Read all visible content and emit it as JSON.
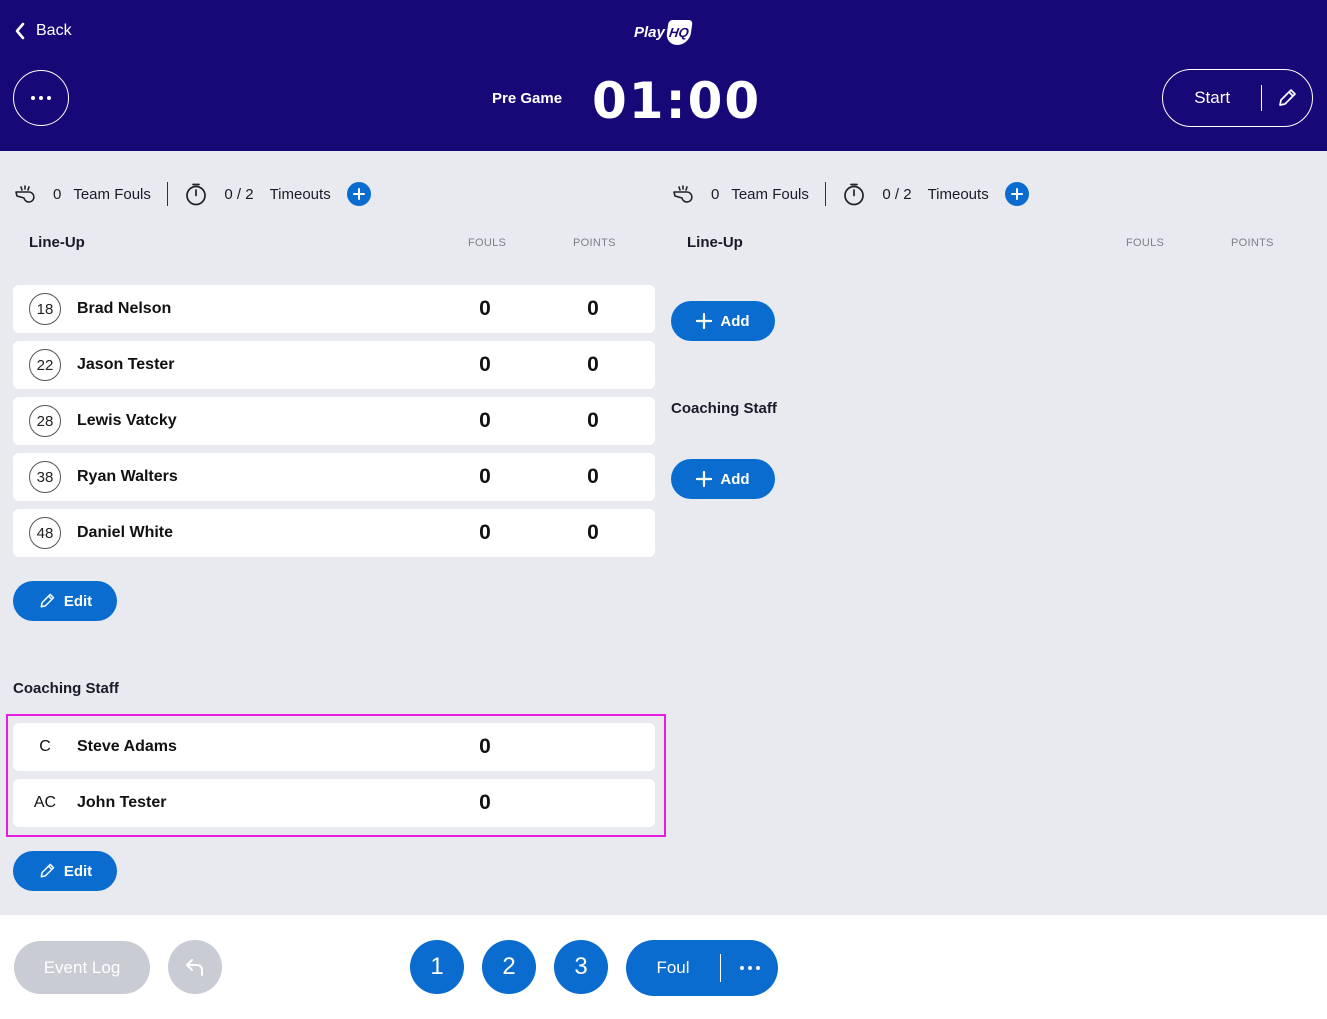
{
  "header": {
    "back_label": "Back",
    "logo_text": "Play",
    "logo_badge": "HQ",
    "period": "Pre Game",
    "clock": "01:00",
    "start_label": "Start"
  },
  "home": {
    "team_fouls_count": "0",
    "team_fouls_label": "Team Fouls",
    "timeouts_value": "0 / 2",
    "timeouts_label": "Timeouts",
    "lineup_title": "Line-Up",
    "fouls_header": "FOULS",
    "points_header": "POINTS",
    "players": [
      {
        "number": "18",
        "name": "Brad Nelson",
        "fouls": "0",
        "points": "0"
      },
      {
        "number": "22",
        "name": "Jason Tester",
        "fouls": "0",
        "points": "0"
      },
      {
        "number": "28",
        "name": "Lewis Vatcky",
        "fouls": "0",
        "points": "0"
      },
      {
        "number": "38",
        "name": "Ryan Walters",
        "fouls": "0",
        "points": "0"
      },
      {
        "number": "48",
        "name": "Daniel White",
        "fouls": "0",
        "points": "0"
      }
    ],
    "lineup_edit_label": "Edit",
    "coaching_title": "Coaching Staff",
    "staff": [
      {
        "role": "C",
        "name": "Steve Adams",
        "fouls": "0"
      },
      {
        "role": "AC",
        "name": "John Tester",
        "fouls": "0"
      }
    ],
    "staff_edit_label": "Edit"
  },
  "away": {
    "team_fouls_count": "0",
    "team_fouls_label": "Team Fouls",
    "timeouts_value": "0 / 2",
    "timeouts_label": "Timeouts",
    "lineup_title": "Line-Up",
    "fouls_header": "FOULS",
    "points_header": "POINTS",
    "lineup_add_label": "Add",
    "coaching_title": "Coaching Staff",
    "staff_add_label": "Add"
  },
  "footer": {
    "event_log_label": "Event Log",
    "score_buttons": [
      "1",
      "2",
      "3"
    ],
    "foul_label": "Foul"
  },
  "colors": {
    "header_bg": "#170878",
    "accent_blue": "#0a6ccf",
    "page_bg": "#e8eaf0",
    "highlight": "#e81cdc",
    "disabled": "#c9ccd4"
  },
  "icons": [
    "back-chevron-icon",
    "more-icon",
    "pencil-icon",
    "whistle-icon",
    "stopwatch-icon",
    "plus-icon",
    "undo-icon"
  ]
}
